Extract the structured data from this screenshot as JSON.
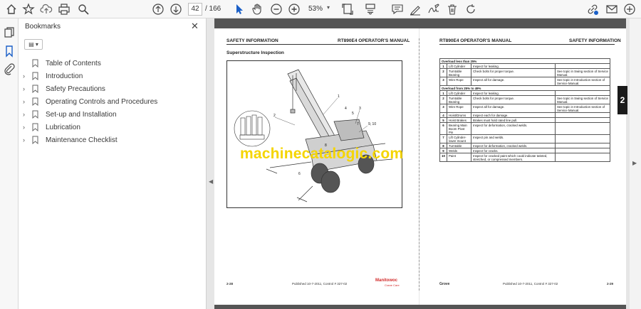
{
  "toolbar": {
    "page_current": "42",
    "page_total": "/ 166",
    "zoom": "53%",
    "icons": [
      "home-icon",
      "star-icon",
      "upload-icon",
      "print-icon",
      "search-icon",
      "page-up-icon",
      "page-down-icon",
      "select-cursor-icon",
      "hand-icon",
      "zoom-out-icon",
      "zoom-in-icon",
      "fit-page-icon",
      "scroll-mode-icon",
      "comment-icon",
      "highlight-icon",
      "sign-icon",
      "trash-icon",
      "rotate-icon",
      "share-link-icon",
      "mail-icon",
      "account-icon"
    ]
  },
  "sidebar": {
    "title": "Bookmarks",
    "close": "✕",
    "options": "▤ ▾",
    "items": [
      {
        "label": "Table of Contents",
        "expandable": false
      },
      {
        "label": "Introduction",
        "expandable": true
      },
      {
        "label": "Safety Precautions",
        "expandable": true
      },
      {
        "label": "Operating Controls and Procedures",
        "expandable": true
      },
      {
        "label": "Set-up and Installation",
        "expandable": true
      },
      {
        "label": "Lubrication",
        "expandable": true
      },
      {
        "label": "Maintenance Checklist",
        "expandable": true
      }
    ]
  },
  "left_page": {
    "header_left": "SAFETY INFORMATION",
    "header_right": "RT890E4 OPERATOR'S MANUAL",
    "subtitle": "Superstructure Inspection",
    "figure_callouts": [
      "1",
      "2",
      "3",
      "4",
      "5",
      "6",
      "7",
      "8",
      "9",
      "10",
      "2",
      "3"
    ],
    "page_number": "2-28",
    "published": "Published 10-7-2011, Control # 327-02",
    "brand": "Manitowoc",
    "brand_sub": "Crane Care"
  },
  "watermark": "machinecatalogic.com",
  "right_page": {
    "header_left": "RT890E4 OPERATOR'S MANUAL",
    "header_right": "SAFETY INFORMATION",
    "sections": [
      {
        "title": "Overload less than 25%",
        "rows": [
          {
            "num": "1",
            "part": "Lift Cylinder",
            "check": "Inspect for leaking.",
            "note": ""
          },
          {
            "num": "2",
            "part": "Turntable Bearing",
            "check": "Check bolts for proper torque.",
            "note": "See topic in Swing section of Service Manual."
          },
          {
            "num": "3",
            "part": "Wire Rope",
            "check": "Inspect all for damage.",
            "note": "See topic in Introduction section of Service Manual."
          }
        ]
      },
      {
        "title": "Overload from 25% to 49%",
        "rows": [
          {
            "num": "1",
            "part": "Lift Cylinder",
            "check": "Inspect for leaking.",
            "note": ""
          },
          {
            "num": "2",
            "part": "Turntable Bearing",
            "check": "Check bolts for proper torque.",
            "note": "See topic in Swing section of Service Manual."
          },
          {
            "num": "3",
            "part": "Wire Rope",
            "check": "Inspect all for damage.",
            "note": "See topic in Introduction section of Service Manual."
          },
          {
            "num": "4",
            "part": "Hoist/Drums",
            "check": "Inspect each for damage.",
            "note": ""
          },
          {
            "num": "5",
            "part": "Hoist Brakes",
            "check": "Brakes must hold rated line pull.",
            "note": ""
          },
          {
            "num": "6",
            "part": "Bearing Main Boom Pivot Pin",
            "check": "Inspect for deformation, cracked welds.",
            "note": ""
          },
          {
            "num": "7",
            "part": "Lift Cylinder-lower mount",
            "check": "Inspect pin and welds.",
            "note": ""
          },
          {
            "num": "8",
            "part": "Turntable",
            "check": "Inspect for deformation, cracked welds.",
            "note": ""
          },
          {
            "num": "9",
            "part": "Welds",
            "check": "Inspect for cracks.",
            "note": ""
          },
          {
            "num": "10",
            "part": "Paint",
            "check": "Inspect for cracked paint which could indicate twisted, stretched, or compressed members.",
            "note": ""
          }
        ]
      }
    ],
    "tab_marker": "2",
    "footer_brand": "Grove",
    "published": "Published 10-7-2011, Control # 327-02",
    "page_number": "2-29"
  },
  "colors": {
    "watermark": "#f5d500",
    "brand_red": "#d22a2a",
    "page_bar": "#555555"
  }
}
